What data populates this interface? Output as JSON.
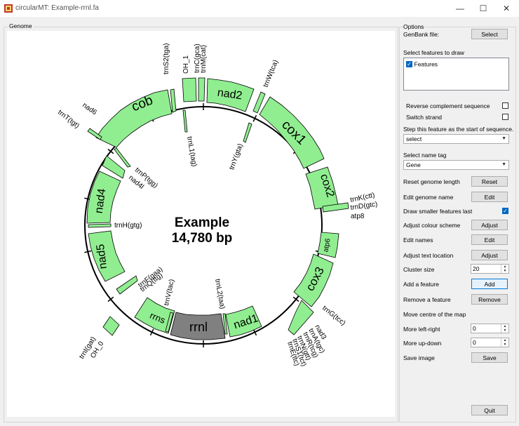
{
  "window": {
    "title": "circularMT: Example-rrnl.fa",
    "minimize": "—",
    "maximize": "☐",
    "close": "✕"
  },
  "genome_group": {
    "label": "Genome"
  },
  "map": {
    "name": "Example",
    "length": "14,780 bp",
    "feature_color": "#90ee90",
    "selected_color": "#808080",
    "outer_features": [
      {
        "name": "cob"
      },
      {
        "name": "nad2"
      },
      {
        "name": "cox1"
      },
      {
        "name": "cox2"
      },
      {
        "name": "atp6"
      },
      {
        "name": "cox3"
      },
      {
        "name": "nad1"
      },
      {
        "name": "rrnl",
        "selected": true
      },
      {
        "name": "rrns"
      },
      {
        "name": "nad5"
      },
      {
        "name": "nad4"
      }
    ],
    "labels": [
      "trnS2(tga)",
      "OH_1",
      "trnC(gca)",
      "trnM(cat)",
      "trnW(tca)",
      "nad6",
      "trnT(tgt)",
      "trnL1(tag)",
      "trnY(gta)",
      "trnP(tgg)",
      "nad4l",
      "trnK(ctt)",
      "trnD(gtc)",
      "atp8",
      "trnH(gtg)",
      "trnF(gaa)",
      "trnQ(ttg)",
      "trnV(tac)",
      "trnL2(taa)",
      "trnG(tcc)",
      "nad3",
      "trnA(tgc)",
      "trnR(tcg)",
      "trnN(gtt)",
      "trnS1(tct)",
      "trnE(ttc)",
      "trnI(gat)",
      "OH_0"
    ]
  },
  "options": {
    "group_label": "Options",
    "genbank_label": "GenBank file:",
    "select_button": "Select",
    "features_label": "Select features to draw",
    "features_item": "Features",
    "reverse_label": "Reverse complement sequence",
    "switch_label": "Switch strand",
    "start_label": "Step this feature as the start of sequence.",
    "start_value": "select",
    "name_tag_label": "Select name tag",
    "name_tag_value": "Gene",
    "reset_length_label": "Reset genome length",
    "reset_button": "Reset",
    "edit_genome_label": "Edit genome name",
    "edit_button": "Edit",
    "draw_smaller_label": "Draw smaller features last",
    "colour_label": "Adjust colour scheme",
    "adjust_button": "Adjust",
    "edit_names_label": "Edit names",
    "edit_names_button": "Edit",
    "text_location_label": "Adjust text location",
    "text_location_button": "Adjust",
    "cluster_label": "Cluster size",
    "cluster_value": "20",
    "add_feature_label": "Add a feature",
    "add_button": "Add",
    "remove_feature_label": "Remove a feature",
    "remove_button": "Remove",
    "move_centre_label": "Move centre of the map",
    "left_right_label": "More left-right",
    "left_right_value": "0",
    "up_down_label": "More up-down",
    "up_down_value": "0",
    "save_label": "Save image",
    "save_button": "Save",
    "quit_button": "Quit"
  }
}
